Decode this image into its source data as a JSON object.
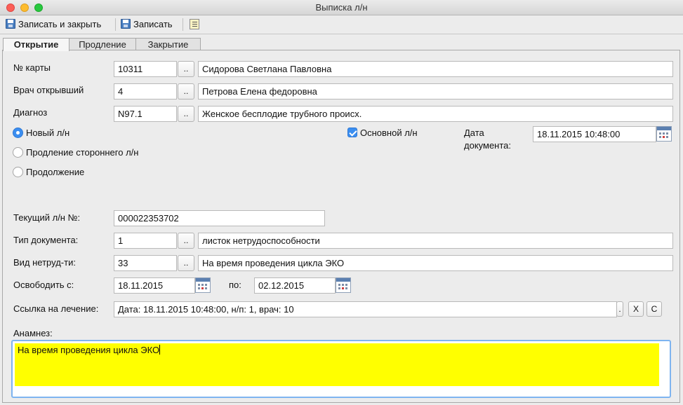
{
  "window": {
    "title": "Выписка л/н"
  },
  "toolbar": {
    "save_close_label": "Записать и закрыть",
    "save_label": "Записать"
  },
  "tabs": [
    {
      "label": "Открытие",
      "active": true
    },
    {
      "label": "Продление",
      "active": false
    },
    {
      "label": "Закрытие",
      "active": false
    }
  ],
  "form": {
    "card": {
      "label": "№ карты",
      "code": "10311",
      "name": "Сидорова Светлана Павловна"
    },
    "doctor": {
      "label": "Врач открывший",
      "code": "4",
      "name": "Петрова Елена федоровна"
    },
    "diagnosis": {
      "label": "Диагноз",
      "code": "N97.1",
      "name": "Женское бесплодие трубного происх."
    },
    "radios": [
      {
        "label": "Новый л/н",
        "checked": true
      },
      {
        "label": "Продление стороннего л/н",
        "checked": false
      },
      {
        "label": "Продолжение",
        "checked": false
      }
    ],
    "main_ln": {
      "label": "Основной л/н",
      "checked": true
    },
    "doc_date": {
      "label_line1": "Дата",
      "label_line2": "документа:",
      "value": "18.11.2015 10:48:00"
    },
    "current_ln": {
      "label": "Текущий л/н №:",
      "value": "000022353702"
    },
    "doc_type": {
      "label": "Тип документа:",
      "code": "1",
      "name": "листок нетрудоспособности"
    },
    "disability_type": {
      "label": "Вид нетруд-ти:",
      "code": "33",
      "name": "На время проведения цикла ЭКО"
    },
    "release_from": {
      "label": "Освободить с:",
      "value": "18.11.2015"
    },
    "release_to": {
      "label": "по:",
      "value": "02.12.2015"
    },
    "treatment_link": {
      "label": "Ссылка на лечение:",
      "value": "Дата: 18.11.2015 10:48:00, н/п: 1, врач: 10",
      "clear_label": "X",
      "c_label": "C"
    },
    "anamnez": {
      "label": "Анамнез:",
      "value": "На время проведения цикла ЭКО"
    }
  },
  "colors": {
    "anamnez_bg": "#ffff00",
    "accent": "#3b8ef0"
  }
}
